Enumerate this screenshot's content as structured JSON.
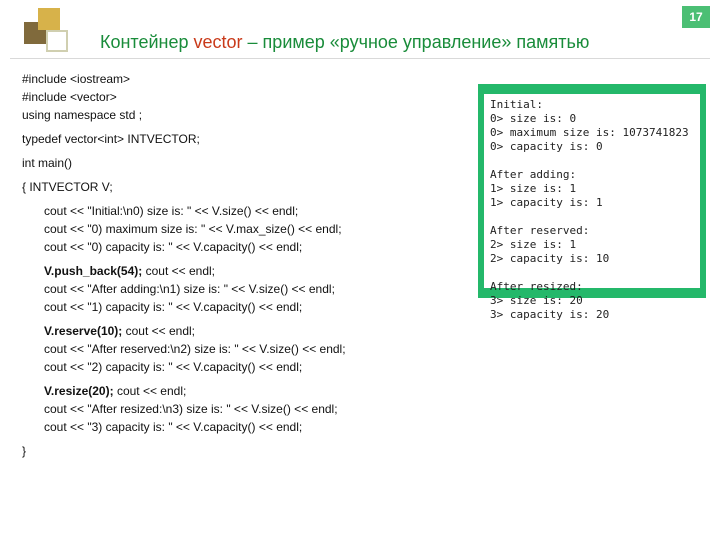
{
  "page_number": "17",
  "title": {
    "part1": "Контейнер ",
    "part2": "vector",
    "part3": " – пример «ручное управление» памятью"
  },
  "code": {
    "l0": "#include <iostream>",
    "l1": "#include <vector>",
    "l2": "using namespace std ;",
    "l3": "typedef vector<int> INTVECTOR;",
    "l4": "int main()",
    "l5": "{    INTVECTOR V;",
    "l6": "cout << \"Initial:\\n0) size is: \" << V.size() << endl;",
    "l7": "cout << \"0) maximum size is: \" << V.max_size() << endl;",
    "l8": "cout << \"0) capacity is: \" << V.capacity() << endl;",
    "l9a": "V.push_back(54);",
    "l9b": "     cout << endl;",
    "l10": "cout << \"After adding:\\n1) size is: \" << V.size() << endl;",
    "l11": "cout << \"1) capacity is: \" << V.capacity() << endl;",
    "l12a": "V.reserve(10);",
    "l12b": "      cout << endl;",
    "l13": "cout << \"After reserved:\\n2) size is: \" << V.size() << endl;",
    "l14": "cout << \"2) capacity is: \" << V.capacity() << endl;",
    "l15a": "V.resize(20);",
    "l15b": "    cout << endl;",
    "l16": "cout << \"After resized:\\n3) size is: \" << V.size() << endl;",
    "l17": "cout << \"3) capacity is: \" << V.capacity() << endl;",
    "l18": "}"
  },
  "terminal": {
    "t0": "Initial:",
    "t1": "0> size is: 0",
    "t2": "0> maximum size is: 1073741823",
    "t3": "0> capacity is: 0",
    "t4": "",
    "t5": "After adding:",
    "t6": "1> size is: 1",
    "t7": "1> capacity is: 1",
    "t8": "",
    "t9": "After reserved:",
    "t10": "2> size is: 1",
    "t11": "2> capacity is: 10",
    "t12": "",
    "t13": "After resized:",
    "t14": "3> size is: 20",
    "t15": "3> capacity is: 20"
  }
}
